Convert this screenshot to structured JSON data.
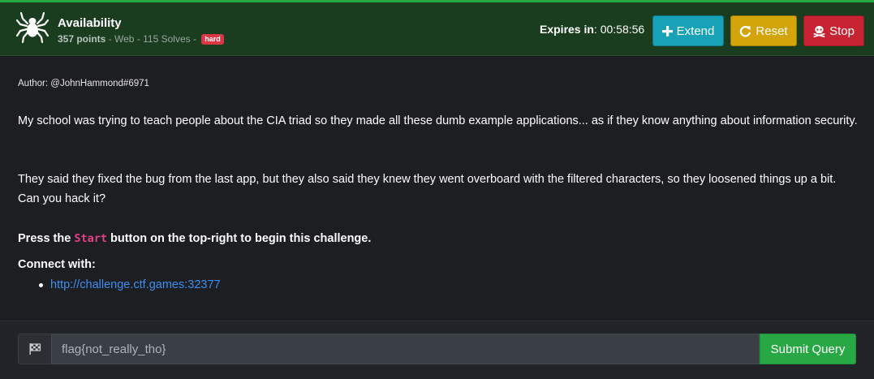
{
  "header": {
    "title": "Availability",
    "points": "357 points",
    "meta_rest": " - Web - 115 Solves - ",
    "difficulty": "hard",
    "expires_label": "Expires in",
    "expires_sep": ": ",
    "expires_value": "00:58:56",
    "buttons": {
      "extend": "Extend",
      "reset": "Reset",
      "stop": "Stop"
    },
    "icons": {
      "logo": "spider-icon",
      "extend": "plus-icon",
      "reset": "redo-icon",
      "stop": "skull-crossbones-icon"
    }
  },
  "description": {
    "author": "Author: @JohnHammond#6971",
    "paragraph1": "My school was trying to teach people about the CIA triad so they made all these dumb example applications... as if they know anything about information security.",
    "paragraph2": "They said they fixed the bug from the last app, but they also said they knew they went overboard with the filtered characters, so they loosened things up a bit. Can you hack it?",
    "press_before": "Press the ",
    "press_code": "Start",
    "press_after": " button on the top-right to begin this challenge.",
    "connect_label": "Connect with:",
    "connect_link": "http://challenge.ctf.games:32377"
  },
  "flag_form": {
    "icon": "checkered-flag-icon",
    "input_value": "flag{not_really_tho}",
    "submit_label": "Submit Query"
  },
  "colors": {
    "header_bg": "#1a3d1f",
    "accent_green": "#28a745",
    "extend": "#17a2b8",
    "reset": "#d4a50a",
    "stop": "#c82333",
    "badge": "#dc3545",
    "link": "#3d8ef0",
    "code": "#e83e8c"
  }
}
